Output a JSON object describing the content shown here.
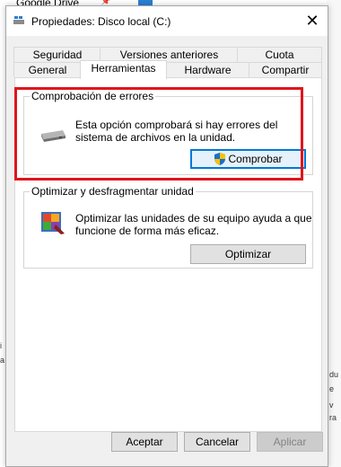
{
  "background": {
    "drive_label": "Google Drive",
    "right_texts": [
      "du",
      "e",
      "v",
      "ra"
    ],
    "left_texts": [
      "i",
      "a"
    ]
  },
  "dialog": {
    "title": "Propiedades: Disco local (C:)",
    "close_glyph": "✕"
  },
  "tabs": {
    "row1": [
      "Seguridad",
      "Versiones anteriores",
      "Cuota"
    ],
    "row2": [
      "General",
      "Herramientas",
      "Hardware",
      "Compartir"
    ],
    "active": "Herramientas"
  },
  "error_check": {
    "title": "Comprobación de errores",
    "description_line1": "Esta opción comprobará si hay errores del",
    "description_line2": "sistema de archivos en la unidad.",
    "button": "Comprobar"
  },
  "optimize": {
    "title": "Optimizar y desfragmentar unidad",
    "description_line1": "Optimizar las unidades de su equipo ayuda a que",
    "description_line2": "funcione de forma más eficaz.",
    "button": "Optimizar"
  },
  "footer": {
    "ok": "Aceptar",
    "cancel": "Cancelar",
    "apply": "Aplicar"
  },
  "colors": {
    "highlight": "#e0141c",
    "accent": "#0078d7"
  }
}
